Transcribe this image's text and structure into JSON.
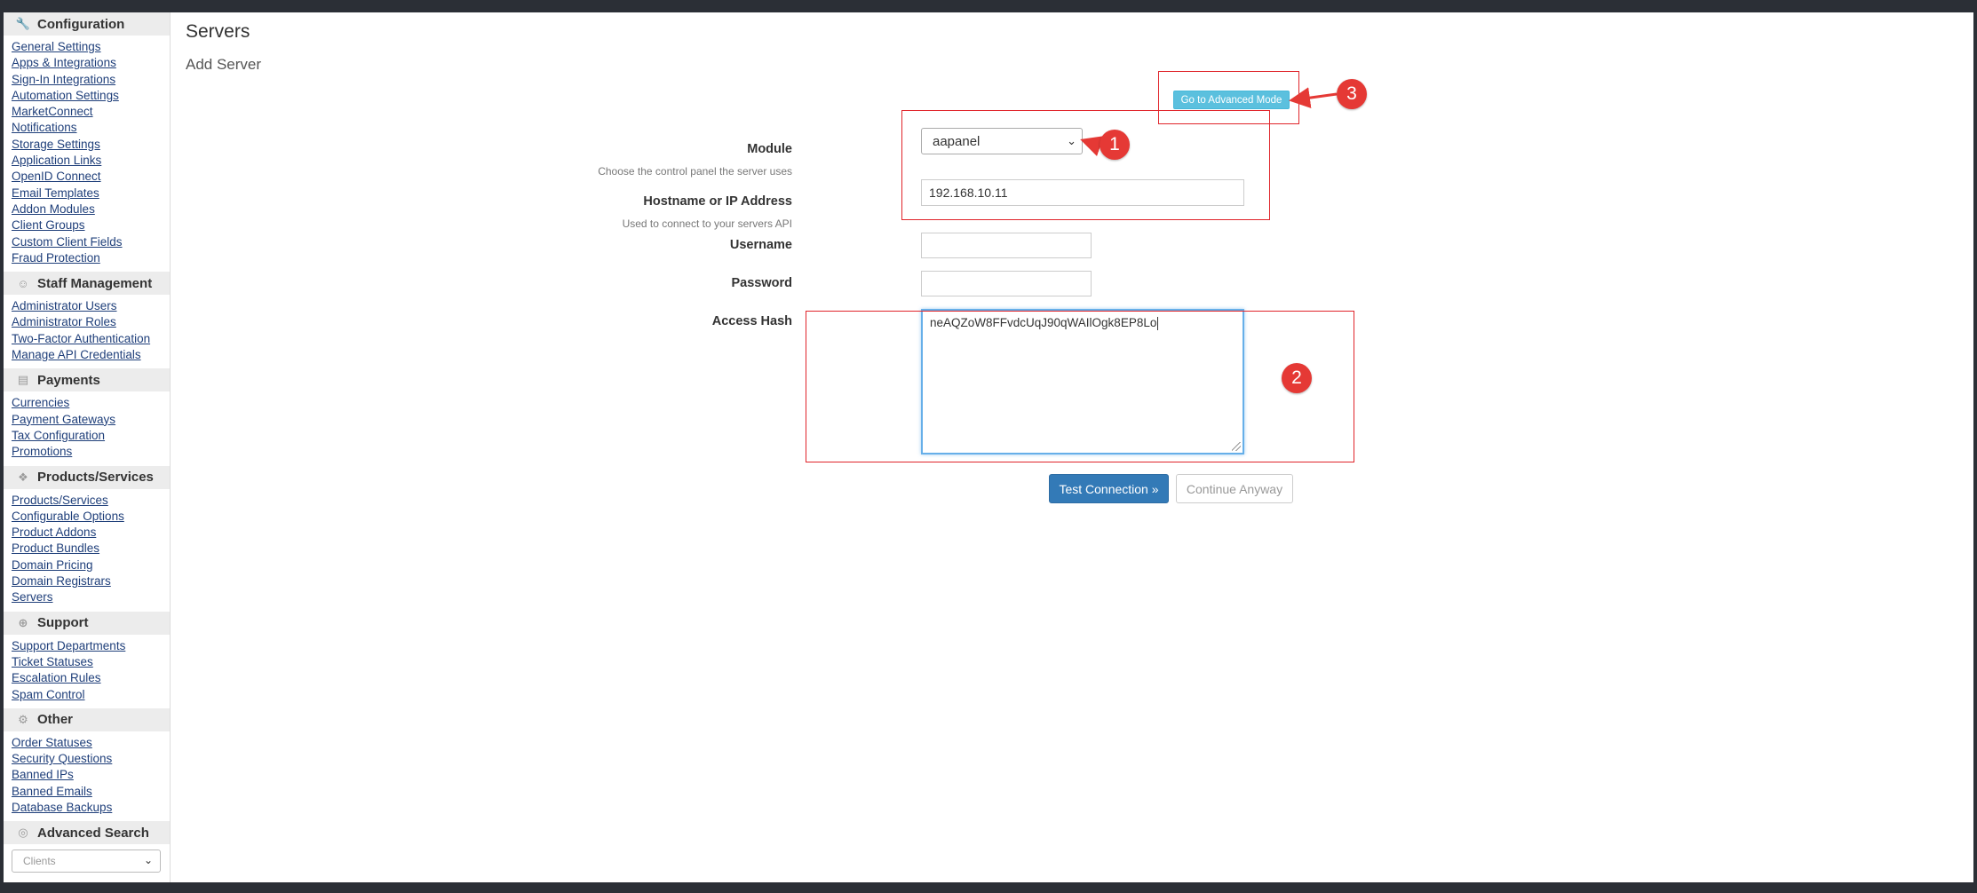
{
  "sidebar": {
    "sections": [
      {
        "title": "Configuration",
        "icon": "wrench-icon",
        "items": [
          "General Settings",
          "Apps & Integrations",
          "Sign-In Integrations",
          "Automation Settings",
          "MarketConnect",
          "Notifications",
          "Storage Settings",
          "Application Links",
          "OpenID Connect",
          "Email Templates",
          "Addon Modules",
          "Client Groups",
          "Custom Client Fields",
          "Fraud Protection"
        ]
      },
      {
        "title": "Staff Management",
        "icon": "users-icon",
        "items": [
          "Administrator Users",
          "Administrator Roles",
          "Two-Factor Authentication",
          "Manage API Credentials"
        ]
      },
      {
        "title": "Payments",
        "icon": "money-icon",
        "items": [
          "Currencies",
          "Payment Gateways",
          "Tax Configuration",
          "Promotions"
        ]
      },
      {
        "title": "Products/Services",
        "icon": "cubes-icon",
        "items": [
          "Products/Services",
          "Configurable Options",
          "Product Addons",
          "Product Bundles",
          "Domain Pricing",
          "Domain Registrars",
          "Servers"
        ]
      },
      {
        "title": "Support",
        "icon": "lifebuoy-icon",
        "items": [
          "Support Departments",
          "Ticket Statuses",
          "Escalation Rules",
          "Spam Control"
        ]
      },
      {
        "title": "Other",
        "icon": "gear-icon",
        "items": [
          "Order Statuses",
          "Security Questions",
          "Banned IPs",
          "Banned Emails",
          "Database Backups"
        ]
      },
      {
        "title": "Advanced Search",
        "icon": "binoculars-icon",
        "items": []
      }
    ],
    "search_select": "Clients"
  },
  "page": {
    "title": "Servers",
    "subtitle": "Add Server"
  },
  "advanced_mode_label": "Go to Advanced Mode",
  "form": {
    "module": {
      "label": "Module",
      "help": "Choose the control panel the server uses",
      "value": "aapanel"
    },
    "hostname": {
      "label": "Hostname or IP Address",
      "help": "Used to connect to your servers API",
      "value": "192.168.10.11"
    },
    "username": {
      "label": "Username",
      "value": ""
    },
    "password": {
      "label": "Password",
      "value": ""
    },
    "access_hash": {
      "label": "Access Hash",
      "value": "neAQZoW8FFvdcUqJ90qWAIlOgk8EP8Lo"
    }
  },
  "buttons": {
    "test_connection": "Test Connection »",
    "continue_anyway": "Continue Anyway"
  },
  "annotations": {
    "badge1": "1",
    "badge2": "2",
    "badge3": "3"
  },
  "colors": {
    "annotation_red": "#e53935",
    "primary_blue": "#337ab7",
    "info_blue": "#5bc0de"
  }
}
